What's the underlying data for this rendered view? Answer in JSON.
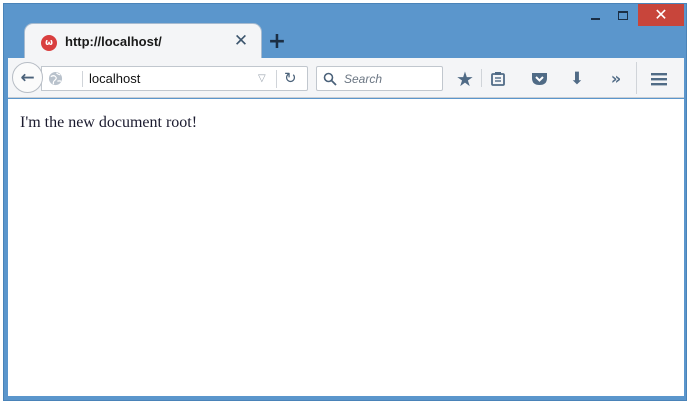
{
  "window": {
    "controls": {
      "minimize": "minimize",
      "maximize": "maximize",
      "close": "✕"
    }
  },
  "tab": {
    "title": "http://localhost/",
    "close_glyph": "✕",
    "favicon_glyph": "ω",
    "icon": "wamp-favicon-icon"
  },
  "new_tab_glyph": "+",
  "toolbar": {
    "back_glyph": "←",
    "address": "localhost",
    "dropmarker_glyph": "▽",
    "reload_glyph": "↻",
    "search_placeholder": "Search",
    "bookmark_glyph": "★",
    "download_glyph": "⬇",
    "overflow_glyph": "»",
    "icons": [
      "back-arrow-icon",
      "globe-icon",
      "reload-icon",
      "search-icon",
      "bookmark-star-icon",
      "reading-list-icon",
      "pocket-icon",
      "download-icon",
      "overflow-chevron-icon",
      "hamburger-menu-icon"
    ]
  },
  "content": {
    "text": "I'm the new document root!"
  },
  "colors": {
    "window_frame": "#5b96cc",
    "close_button": "#c8453b",
    "toolbar_icon": "#506b86"
  }
}
